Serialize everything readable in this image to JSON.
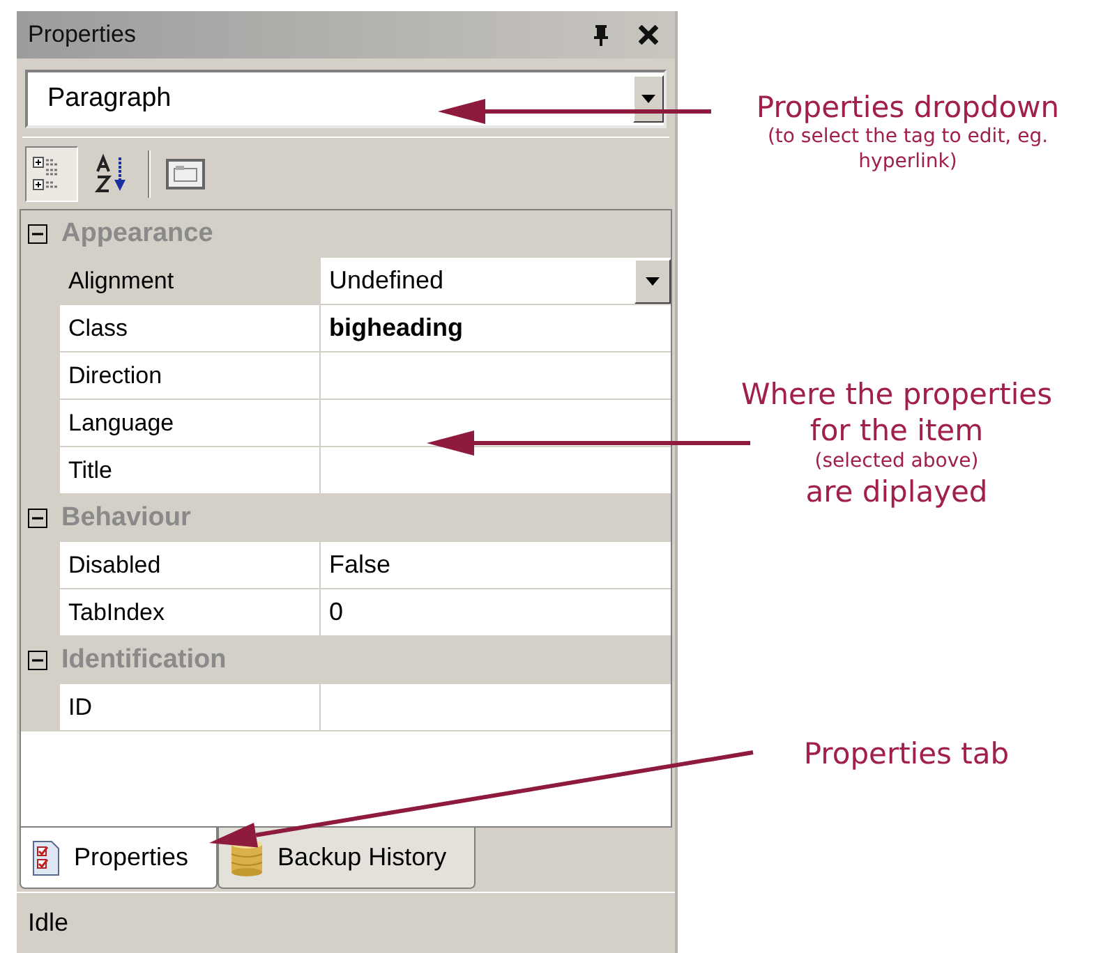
{
  "panel": {
    "title": "Properties",
    "selector": {
      "value": "Paragraph"
    },
    "toolbar": [
      {
        "kind": "categorized",
        "selected": true
      },
      {
        "kind": "alphabetical",
        "selected": false
      },
      {
        "kind": "pages",
        "selected": false
      }
    ],
    "categories": [
      {
        "name": "Appearance",
        "expanded": true,
        "properties": [
          {
            "name": "Alignment",
            "value": "Undefined",
            "kind": "dropdown",
            "modified": false
          },
          {
            "name": "Class",
            "value": "bigheading",
            "kind": "text",
            "modified": true
          },
          {
            "name": "Direction",
            "kind": "text"
          },
          {
            "name": "Language",
            "kind": "text"
          },
          {
            "name": "Title",
            "kind": "text"
          }
        ]
      },
      {
        "name": "Behaviour",
        "expanded": true,
        "properties": [
          {
            "name": "Disabled",
            "value": "False",
            "kind": "text",
            "modified": false
          },
          {
            "name": "TabIndex",
            "value": "0",
            "kind": "text",
            "modified": false
          }
        ]
      },
      {
        "name": "Identification",
        "expanded": true,
        "properties": [
          {
            "name": "ID",
            "kind": "text"
          }
        ]
      }
    ],
    "tabs": [
      {
        "label": "Properties",
        "selected": true
      },
      {
        "label": "Backup History",
        "selected": false
      }
    ],
    "status_bar": "Idle"
  },
  "annotations": [
    {
      "lines": [
        {
          "text": "Properties dropdown",
          "kind": "main"
        },
        {
          "text": "(to select the tag to edit, eg. hyperlink)",
          "kind": "note"
        }
      ]
    },
    {
      "lines": [
        {
          "text": "Where the properties for the item",
          "kind": "main"
        },
        {
          "text": "(selected above)",
          "kind": "note"
        },
        {
          "text": "are diplayed",
          "kind": "main"
        }
      ]
    },
    {
      "lines": [
        {
          "text": "Properties tab",
          "kind": "main"
        }
      ]
    }
  ]
}
